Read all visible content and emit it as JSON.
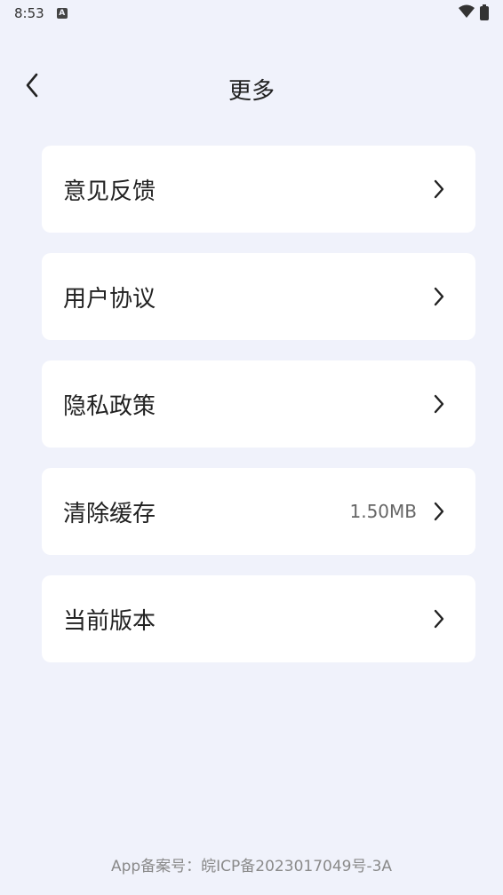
{
  "status_bar": {
    "time": "8:53",
    "notification_icon_letter": "A",
    "wifi_icon": "wifi-icon",
    "battery_icon": "battery-charging-icon"
  },
  "header": {
    "back_icon": "chevron-left-icon",
    "title": "更多"
  },
  "menu": {
    "items": [
      {
        "label": "意见反馈",
        "value": ""
      },
      {
        "label": "用户协议",
        "value": ""
      },
      {
        "label": "隐私政策",
        "value": ""
      },
      {
        "label": "清除缓存",
        "value": "1.50MB"
      },
      {
        "label": "当前版本",
        "value": ""
      }
    ]
  },
  "footer": {
    "record_text": "App备案号：皖ICP备2023017049号-3A"
  },
  "colors": {
    "background": "#f0f2fb",
    "card": "#ffffff",
    "text_primary": "#222222",
    "text_secondary": "#666666",
    "footer_text": "#8a8a8a"
  }
}
